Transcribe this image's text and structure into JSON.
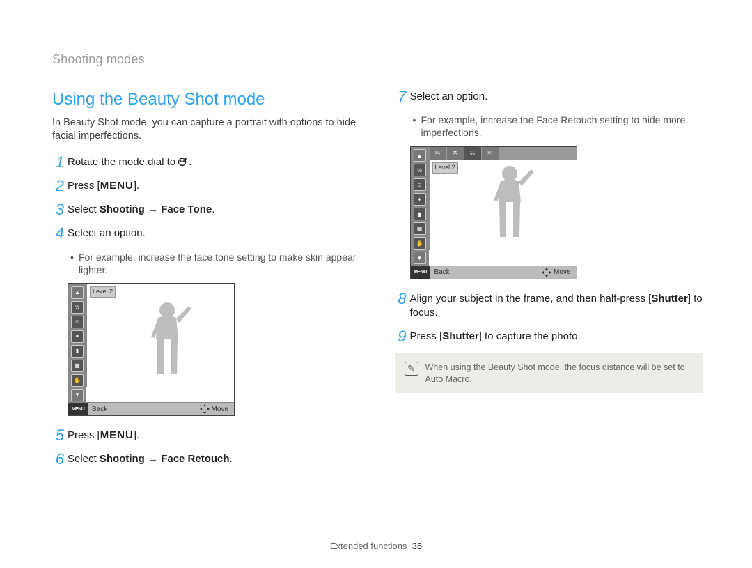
{
  "header": {
    "section": "Shooting modes"
  },
  "title": "Using the Beauty Shot mode",
  "intro": "In Beauty Shot mode, you can capture a portrait with options to hide facial imperfections.",
  "steps": {
    "s1": {
      "num": "1",
      "text_a": "Rotate the mode dial to ",
      "text_b": "."
    },
    "s2": {
      "num": "2",
      "text_a": "Press [",
      "menu": "MENU",
      "text_b": "]."
    },
    "s3": {
      "num": "3",
      "text_a": "Select ",
      "bold_a": "Shooting",
      "arrow": " → ",
      "bold_b": "Face Tone",
      "text_b": "."
    },
    "s4": {
      "num": "4",
      "text": "Select an option."
    },
    "s4_bullet": "For example, increase the face tone setting to make skin appear lighter.",
    "s5": {
      "num": "5",
      "text_a": "Press [",
      "menu": "MENU",
      "text_b": "]."
    },
    "s6": {
      "num": "6",
      "text_a": "Select ",
      "bold_a": "Shooting",
      "arrow": " → ",
      "bold_b": "Face Retouch",
      "text_b": "."
    },
    "s7": {
      "num": "7",
      "text": "Select an option."
    },
    "s7_bullet": "For example, increase the Face Retouch setting to hide more imperfections.",
    "s8": {
      "num": "8",
      "text_a": "Align your subject in the frame, and then half-press [",
      "bold": "Shutter",
      "text_b": "] to focus."
    },
    "s9": {
      "num": "9",
      "text_a": "Press [",
      "bold": "Shutter",
      "text_b": "] to capture the photo."
    }
  },
  "camera_shot_1": {
    "level": "Level 2",
    "back": "Back",
    "move": "Move",
    "menu": "MENU"
  },
  "camera_shot_2": {
    "level": "Level 2",
    "back": "Back",
    "move": "Move",
    "menu": "MENU"
  },
  "note": "When using the Beauty Shot mode, the focus distance will be set to Auto Macro.",
  "footer": {
    "label": "Extended functions",
    "page": "36"
  }
}
